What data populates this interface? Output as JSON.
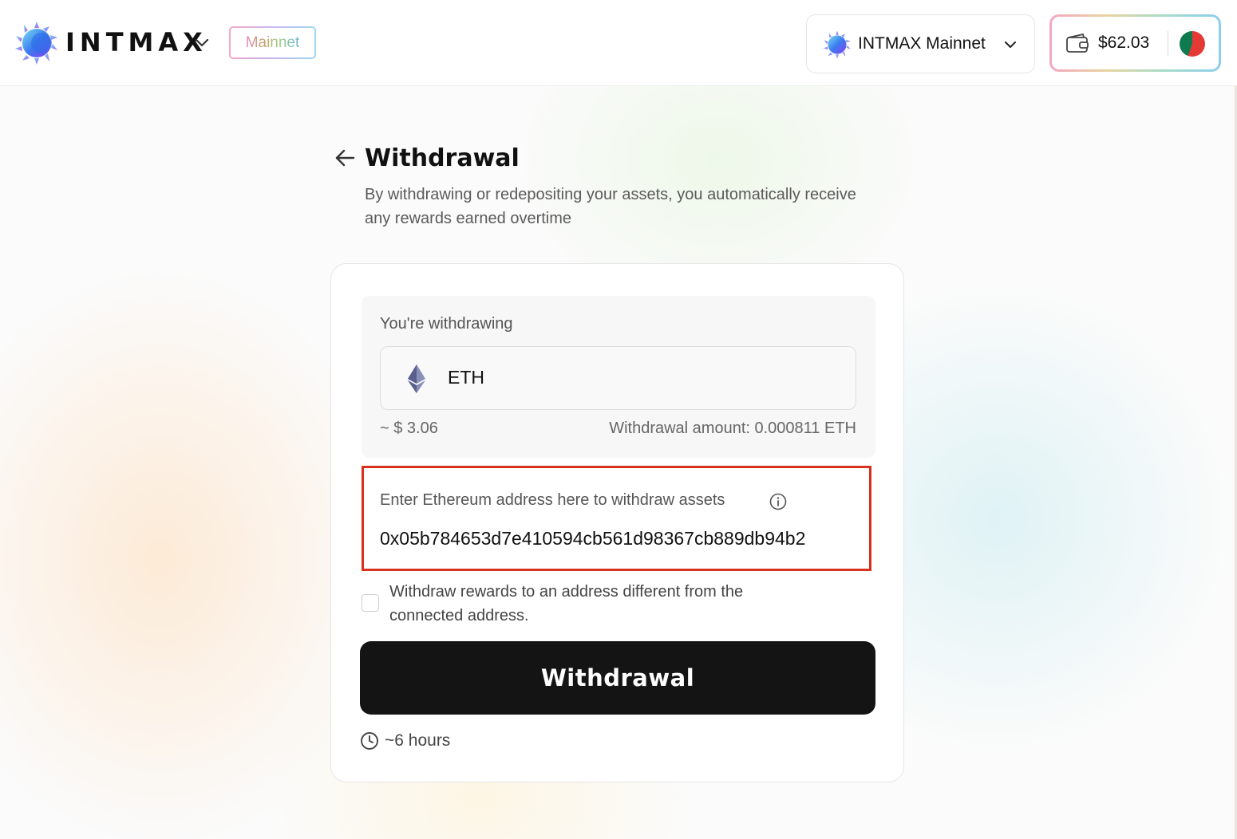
{
  "header": {
    "brand": "INTMAX",
    "network_badge": "Mainnet",
    "network_selector": "INTMAX Mainnet",
    "wallet_balance": "$62.03"
  },
  "page": {
    "title": "Withdrawal",
    "subtitle": "By withdrawing or redepositing your assets, you automatically receive any rewards earned overtime"
  },
  "withdraw": {
    "label": "You're withdrawing",
    "token": "ETH",
    "usd_value": "~ $ 3.06",
    "amount_text": "Withdrawal amount: 0.000811 ETH"
  },
  "address": {
    "label": "Enter Ethereum address here to withdraw assets",
    "value": "0x05b784653d7e410594cb561d98367cb889db94b2"
  },
  "checkbox": {
    "label": "Withdraw rewards to an address different from the connected address."
  },
  "button": {
    "label": "Withdrawal"
  },
  "estimate": {
    "time": "~6 hours"
  },
  "colors": {
    "highlight_border": "#d8321f",
    "button_bg": "#141414"
  }
}
